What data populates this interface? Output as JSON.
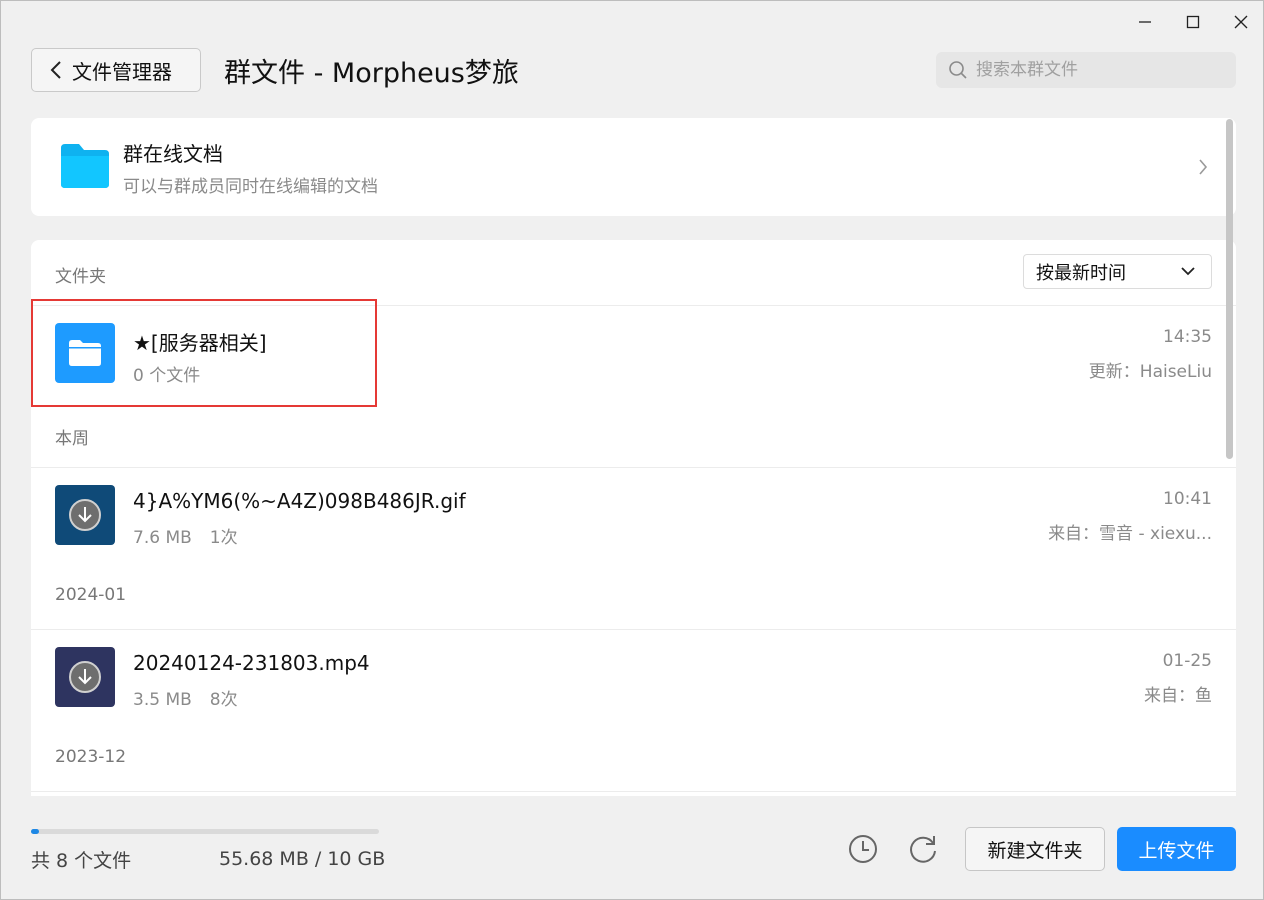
{
  "window": {
    "controls": [
      "minimize-icon",
      "maximize-icon",
      "close-icon"
    ]
  },
  "header": {
    "back_label": "文件管理器",
    "title": "群文件 - Morpheus梦旅",
    "search_placeholder": "搜索本群文件"
  },
  "online_docs": {
    "title": "群在线文档",
    "subtitle": "可以与群成员同时在线编辑的文档"
  },
  "list": {
    "folder_section_label": "文件夹",
    "sort_label": "按最新时间",
    "folder": {
      "name": "★[服务器相关]",
      "count": "0 个文件",
      "time": "14:35",
      "updated_by": "更新：HaiseLiu"
    },
    "groups": [
      {
        "label": "本周",
        "files": [
          {
            "name": "4}A%YM6(%~A4Z)098B486JR.gif",
            "size": "7.6 MB",
            "downloads": "1次",
            "time": "10:41",
            "source": "来自：雪音 - xiexu...",
            "thumb_color": "#0f4a78"
          }
        ]
      },
      {
        "label": "2024-01",
        "files": [
          {
            "name": "20240124-231803.mp4",
            "size": "3.5 MB",
            "downloads": "8次",
            "time": "01-25",
            "source": "来自：鱼",
            "thumb_color": "#2e3460"
          }
        ]
      },
      {
        "label": "2023-12",
        "files": []
      }
    ]
  },
  "footer": {
    "file_count": "共 8 个文件",
    "storage": "55.68 MB / 10 GB",
    "storage_used_fraction": 0.0054,
    "new_folder_label": "新建文件夹",
    "upload_label": "上传文件"
  },
  "colors": {
    "accent": "#1a8cff",
    "folder_blue": "#1e9bff",
    "highlight": "#e53935"
  }
}
